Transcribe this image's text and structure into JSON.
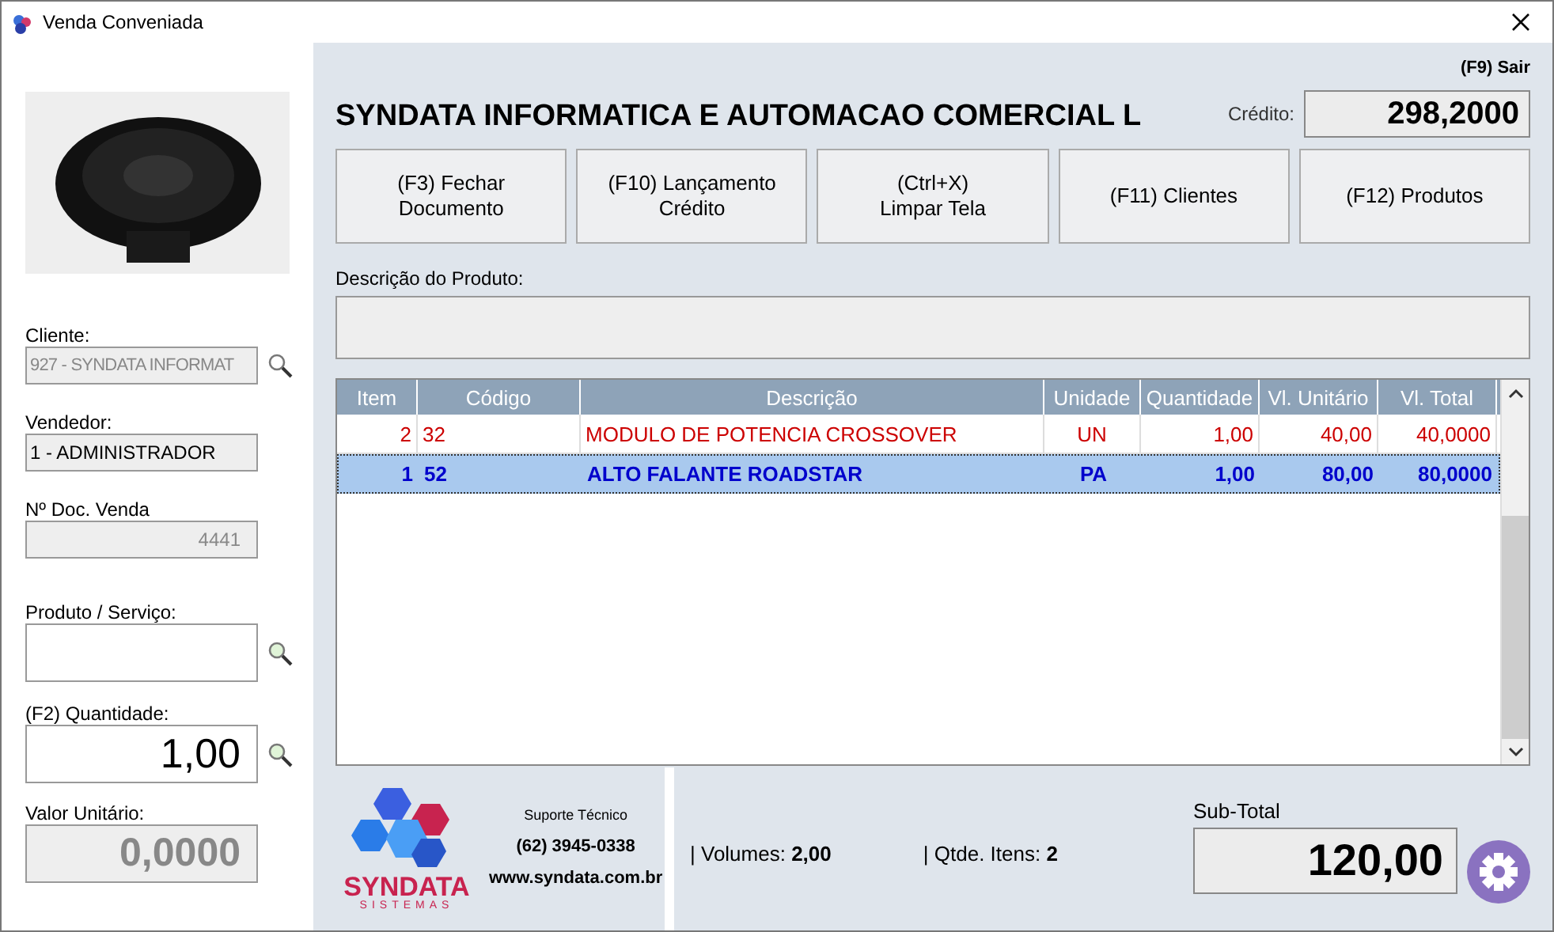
{
  "window": {
    "title": "Venda Conveniada"
  },
  "sidebar": {
    "fields": [
      {
        "label": "Cliente:",
        "value": "927 - SYNDATA INFORMAT",
        "kind": "lookup",
        "disabled": true
      },
      {
        "label": "Vendedor:",
        "value": "1 - ADMINISTRADOR",
        "kind": "plain",
        "disabled": true
      },
      {
        "label": "Nº Doc. Venda",
        "value": "4441",
        "kind": "plain",
        "disabled": true
      },
      {
        "label": "Produto / Serviço:",
        "kind": "lookup",
        "disabled": false
      },
      {
        "label": "(F2) Quantidade:",
        "value": "1,00",
        "kind": "lookup",
        "disabled": false
      },
      {
        "label": "Valor Unitário:",
        "value": "0,0000",
        "kind": "plain",
        "disabled": true
      }
    ]
  },
  "header": {
    "exit": "(F9) Sair",
    "company": "SYNDATA INFORMATICA E AUTOMACAO COMERCIAL L",
    "credit_label": "Crédito:",
    "credit_value": "298,2000"
  },
  "buttons": [
    "(F3) Fechar Documento",
    "(F10) Lançamento\nCrédito",
    "(Ctrl+X)\nLimpar Tela",
    "(F11) Clientes",
    "(F12) Produtos"
  ],
  "description": {
    "label": "Descrição do Produto:"
  },
  "table": {
    "columns": [
      "Item",
      "Código",
      "Descrição",
      "Unidade",
      "Quantidade",
      "Vl. Unitário",
      "Vl. Total"
    ],
    "rows": [
      {
        "cells": [
          "2",
          "32",
          "MODULO DE POTENCIA CROSSOVER",
          "UN",
          "1,00",
          "40,00",
          "40,0000"
        ],
        "selected": false,
        "color": "#cc0000"
      },
      {
        "cells": [
          "1",
          "52",
          "ALTO FALANTE ROADSTAR",
          "PA",
          "1,00",
          "80,00",
          "80,0000"
        ],
        "selected": true,
        "color": "#0000cc"
      }
    ]
  },
  "footer": {
    "logo_name": "SYNDATA",
    "logo_sub": "SISTEMAS",
    "support_label": "Suporte Técnico",
    "phone": "(62) 3945-0338",
    "site": "www.syndata.com.br",
    "volumes_label": "| Volumes:",
    "volumes_value": "2,00",
    "items_label": "| Qtde. Itens:",
    "items_value": "2",
    "subtotal_label": "Sub-Total",
    "subtotal_value": "120,00"
  }
}
